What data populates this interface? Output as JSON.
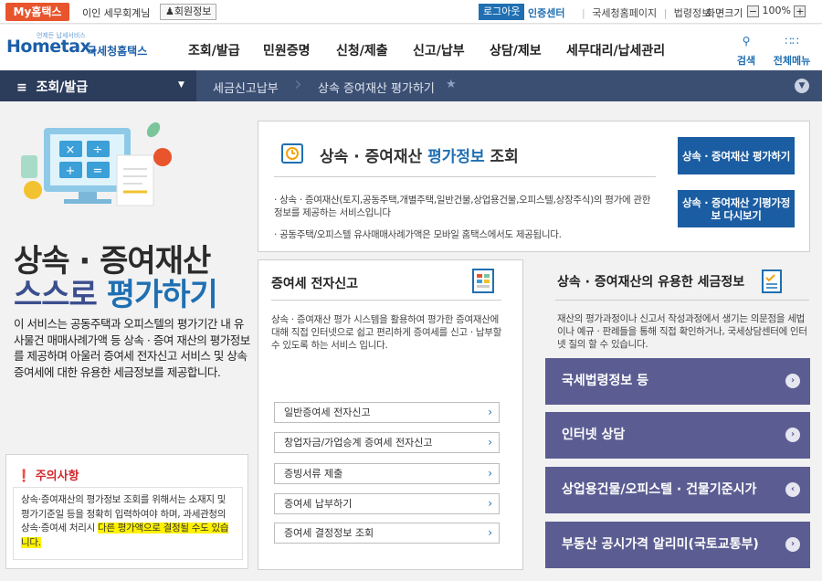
{
  "topbar": {
    "my_hometax": "My홈택스",
    "greeting": "이인 세무회계님",
    "member_info": "회원정보",
    "logout": "로그아웃",
    "cert_center": "인증센터",
    "links": [
      "국세청홈페이지",
      "법령정보"
    ],
    "zoom_label": "화면크기",
    "zoom_minus": "−",
    "zoom_value": "100%",
    "zoom_plus": "+"
  },
  "header": {
    "logo_sub": "언제든 납세서비스",
    "logo_word": "Hometax.",
    "logo_kr": "국세청홈택스",
    "gnb": [
      "조회/발급",
      "민원증명",
      "신청/제출",
      "신고/납부",
      "상담/제보",
      "세무대리/납세관리"
    ],
    "search": "검색",
    "all_menu": "전체메뉴"
  },
  "navbar": {
    "menu": "조회/발급",
    "crumbs": [
      "세금신고납부",
      "상속 증여재산 평가하기"
    ]
  },
  "hero": {
    "title_line1": "상속 · 증여재산",
    "title_line2_a": "스스로 ",
    "title_line2_b": "평가하기",
    "description": "이 서비스는 공동주택과 오피스텔의 평가기간 내 유사물건 매매사례가액 등 상속 · 증여 재산의 평가정보를 제공하며 아울러 증여세 전자신고 서비스 및 상속증여세에 대한 유용한 세금정보를 제공합니다."
  },
  "caution": {
    "title": "주의사항",
    "text_a": "상속·증여재산의 평가정보 조회를 위해서는 소재지 및 평가기준일 등을 정확히 입력하여야 하며, 과세관청의 상속·증여세 처리시 ",
    "text_b": "다른 평가액으로 결정될 수도 있습니다."
  },
  "eval_panel": {
    "title_a": "상속 · 증여재산 ",
    "title_b": "평가정보",
    "title_c": " 조회",
    "desc1": "· 상속 · 증여재산(토지,공동주택,개별주택,일반건물,상업용건물,오피스텔,상장주식)의 평가에 관한 정보를 제공하는 서비스입니다",
    "desc2": "· 공동주택/오피스텔 유사매매사례가액은 모바일 홈택스에서도 제공됩니다.",
    "btn1": "상속 · 증여재산 평가하기",
    "btn2": "상속 · 증여재산 기평가정보 다시보기"
  },
  "efile": {
    "title": "증여세 전자신고",
    "desc": "상속 · 증여재산 평가 시스템을 활용하여 평가한 증여재산에 대해 직접 인터넷으로 쉽고 편리하게 증여세를 신고 · 납부할 수 있도록 하는 서비스 입니다.",
    "links": [
      "일반증여세 전자신고",
      "창업자금/가업승계 증여세 전자신고",
      "증빙서류 제출",
      "증여세 납부하기",
      "증여세 결정정보 조회"
    ]
  },
  "taxinfo": {
    "title": "상속 · 증여재산의 유용한 세금정보",
    "desc": "재산의 평가과정이나 신고서 작성과정에서 생기는 의문점을 세법이나 예규 · 판례들을 통해 직접 확인하거나, 국세상담센터에 인터넷 질의 할 수 있습니다.",
    "buttons": [
      "국세법령정보 등",
      "인터넷 상담",
      "상업용건물/오피스텔 · 건물기준시가",
      "부동산 공시가격 알리미(국토교통부)"
    ]
  },
  "colors": {
    "brand_blue": "#1f6fb2",
    "nav": "#3b4f73",
    "purple": "#5b5d92",
    "alert": "#d3262b",
    "highlight": "#fff200"
  }
}
